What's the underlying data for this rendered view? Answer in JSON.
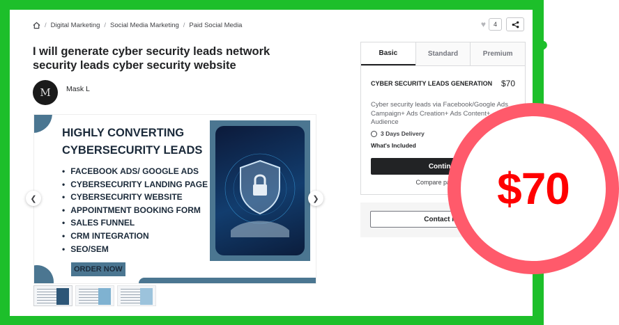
{
  "breadcrumb": {
    "items": [
      "Digital Marketing",
      "Social Media Marketing",
      "Paid Social Media"
    ]
  },
  "actions": {
    "like_count": "4"
  },
  "gig": {
    "title": "I will generate cyber security leads network security leads cyber security website",
    "seller_name": "Mask L",
    "avatar_letter": "M"
  },
  "gallery": {
    "heading_line1": "HIGHLY CONVERTING",
    "heading_line2": "CYBERSECURITY LEADS",
    "bullets": [
      "FACEBOOK ADS/ GOOGLE ADS",
      "CYBERSECURITY LANDING PAGE",
      "CYBERSECURITY WEBSITE",
      "APPOINTMENT BOOKING FORM",
      "SALES FUNNEL",
      "CRM INTEGRATION",
      "SEO/SEM"
    ],
    "cta": "ORDER NOW"
  },
  "package": {
    "tabs": [
      "Basic",
      "Standard",
      "Premium"
    ],
    "name": "CYBER SECURITY LEADS GENERATION",
    "price": "$70",
    "description": "Cyber security leads via Facebook/Google Ads Campaign+ Ads Creation+ Ads Content+ Audience",
    "delivery": "3 Days Delivery",
    "included_label": "What's Included",
    "continue_label": "Continue",
    "compare_label": "Compare packages"
  },
  "contact": {
    "label": "Contact me"
  },
  "overlay": {
    "price": "$70"
  },
  "colors": {
    "frame_green": "#1dbf2a",
    "price_red": "#ff0000",
    "circle_pink": "#ff5a6b",
    "brand_blue": "#4b7691"
  }
}
